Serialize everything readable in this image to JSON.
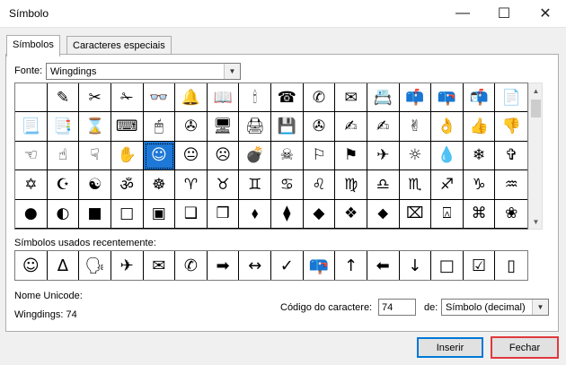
{
  "window": {
    "title": "Símbolo"
  },
  "tabs": [
    {
      "label": "Símbolos",
      "active": true
    },
    {
      "label": "Caracteres especiais",
      "active": false
    }
  ],
  "font": {
    "label": "Fonte:",
    "value": "Wingdings"
  },
  "symbols": [
    "",
    "✎",
    "✂",
    "✁",
    "👓",
    "🔔",
    "📖",
    "🕯",
    "☎",
    "✆",
    "✉",
    "📇",
    "📫",
    "📪",
    "📬",
    "📄",
    "📃",
    "📑",
    "⌛",
    "⌨",
    "🖱",
    "✇",
    "🖥",
    "🖨",
    "💾",
    "✇",
    "✍",
    "✍",
    "✌",
    "👌",
    "👍",
    "👎",
    "☜",
    "☝",
    "☟",
    "✋",
    "☺",
    "😐",
    "☹",
    "💣",
    "☠",
    "⚐",
    "⚑",
    "✈",
    "☼",
    "💧",
    "❄",
    "✞",
    "✡",
    "☪",
    "☯",
    "ॐ",
    "☸",
    "♈",
    "♉",
    "♊",
    "♋",
    "♌",
    "♍",
    "♎",
    "♏",
    "♐",
    "♑",
    "♒",
    "●",
    "◐",
    "■",
    "□",
    "▣",
    "❑",
    "❒",
    "⬧",
    "⧫",
    "◆",
    "❖",
    "⬥",
    "⌧",
    "⍓",
    "⌘",
    "❀"
  ],
  "selected_index": 36,
  "recent_label": "Símbolos usados recentemente:",
  "recent": [
    "☺",
    "Δ",
    "🗣",
    "✈",
    "✉",
    "✆",
    "➡",
    "↔",
    "✓",
    "📪",
    "↑",
    "⬅",
    "↓",
    "□",
    "☑",
    "▯"
  ],
  "unicode": {
    "label": "Nome Unicode:",
    "value": "Wingdings: 74"
  },
  "char_code": {
    "label": "Código do caractere:",
    "value": "74",
    "from_label": "de:",
    "from_value": "Símbolo (decimal)"
  },
  "buttons": {
    "insert": "Inserir",
    "close": "Fechar"
  }
}
